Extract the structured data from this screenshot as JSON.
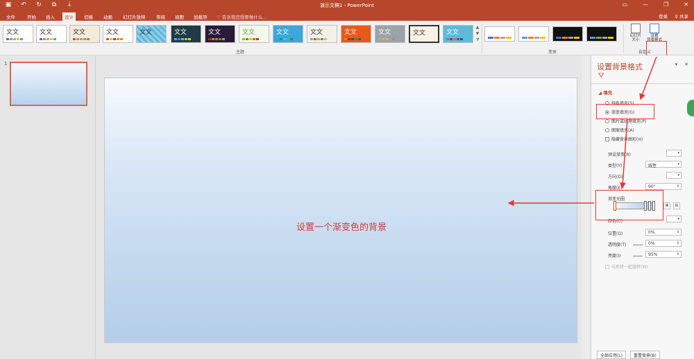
{
  "titlebar": {
    "title": "演示文稿1 - PowerPoint",
    "save_icon": "save-icon",
    "undo_glyph": "↶",
    "redo_glyph": "↻",
    "qat_extra_glyph": "⧉",
    "qat_more_glyph": "⇣",
    "min_glyph": "▭",
    "minimize_glyph": "—",
    "restore_glyph": "❐",
    "close_glyph": "✕",
    "accent": "#b7472a"
  },
  "tabs": [
    {
      "label": "文件"
    },
    {
      "label": "开始"
    },
    {
      "label": "插入"
    },
    {
      "label": "设计"
    },
    {
      "label": "切换"
    },
    {
      "label": "动画"
    },
    {
      "label": "幻灯片放映"
    },
    {
      "label": "审阅"
    },
    {
      "label": "视图"
    },
    {
      "label": "加载项"
    }
  ],
  "tell_me": "♡ 告诉我您想要做什么...",
  "account": {
    "login": "登录",
    "share": "♀ 共享"
  },
  "ribbon": {
    "theme_text": "文文",
    "themes_group_label": "主题",
    "variants_group_label": "变体",
    "customize_group_label": "自定义",
    "slide_size_label": "幻灯片\n大小",
    "format_bg_label": "设置\n背景格式",
    "scroll_up": "▲",
    "scroll_down": "▼",
    "more": "⧩"
  },
  "thumbnails": {
    "number": "1"
  },
  "slide": {
    "text": "设置一个渐变色的背景"
  },
  "pane": {
    "title": "设置背景格式",
    "pin": "▾",
    "close": "✕",
    "paint_icon": "⛛",
    "fill_header": "◢ 填充",
    "options": {
      "solid": "纯色填充(S)",
      "gradient": "渐变填充(G)",
      "picture": "图片或纹理填充(P)",
      "pattern": "图案填充(A)",
      "hide": "隐藏背景图形(H)"
    },
    "preset_label": "预设渐变(R)",
    "type_label": "类型(Y)",
    "type_value": "线性",
    "direction_label": "方向(D)",
    "angle_label": "角度(E)",
    "angle_value": "90°",
    "stops_label": "渐变光圈",
    "color_label": "颜色(C)",
    "position_label": "位置(O)",
    "position_value": "0%",
    "transparency_label": "透明度(T)",
    "transparency_value": "0%",
    "brightness_label": "亮度(I)",
    "brightness_value": "95%",
    "rotate_label": "与形状一起旋转(W)",
    "apply_all": "全部应用(L)",
    "reset": "重置背景(B)"
  }
}
